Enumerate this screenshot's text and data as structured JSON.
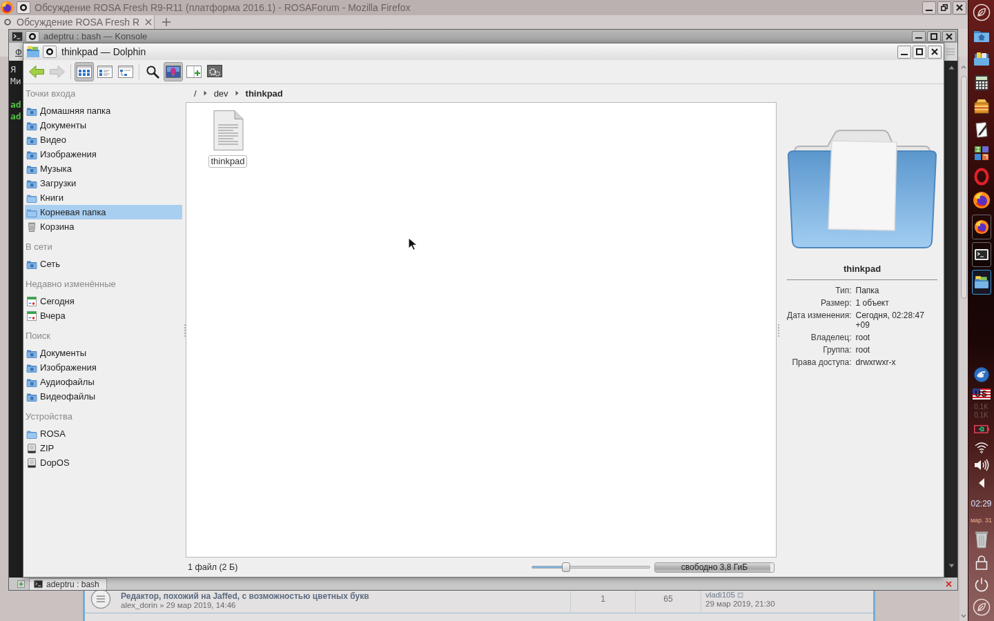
{
  "firefox": {
    "title": "Обсуждение ROSA Fresh R9-R11 (платформа 2016.1) - ROSAForum - Mozilla Firefox",
    "tabs": [
      {
        "label": "Обсуждение ROSA Fresh R",
        "selected": true
      }
    ],
    "topics": [
      {
        "title": "Редактор, похожий на Jaffed, с возможностью цветных букв",
        "byline": "alex_dorin » 29 мар 2019, 14:46",
        "replies": "1",
        "views": "65",
        "last_author": "vladi105",
        "last_date": "29 мар 2019, 21:30"
      }
    ]
  },
  "konsole": {
    "title": "adeptru : bash — Konsole",
    "menu": [
      "Ф"
    ],
    "lines": [
      {
        "kind": "output",
        "text": "Я"
      },
      {
        "kind": "output",
        "text": "Ми"
      },
      {
        "kind": "prompt",
        "text": "ad"
      },
      {
        "kind": "prompt",
        "text": "ad"
      }
    ],
    "sessions": [
      {
        "label": "adeptru : bash",
        "selected": true
      }
    ]
  },
  "dolphin": {
    "title": "thinkpad — Dolphin",
    "toolbar": {
      "navigation": [
        {
          "kind": "back",
          "disabled": false
        },
        {
          "kind": "forward",
          "disabled": true
        }
      ],
      "view_modes": [
        {
          "kind": "icons",
          "selected": true
        },
        {
          "kind": "compact",
          "selected": false
        },
        {
          "kind": "details",
          "selected": false
        }
      ],
      "preview": {
        "on": true
      }
    },
    "places": [
      {
        "heading": "Точки входа",
        "items": [
          {
            "label": "Домашняя папка",
            "kind": "place",
            "selected": false
          },
          {
            "label": "Документы",
            "kind": "place",
            "selected": false
          },
          {
            "label": "Видео",
            "kind": "place",
            "selected": false
          },
          {
            "label": "Изображения",
            "kind": "place",
            "selected": false
          },
          {
            "label": "Музыка",
            "kind": "place",
            "selected": false
          },
          {
            "label": "Загрузки",
            "kind": "place",
            "selected": false
          },
          {
            "label": "Книги",
            "kind": "folder",
            "selected": false
          },
          {
            "label": "Корневая папка",
            "kind": "folder",
            "selected": true
          },
          {
            "label": "Корзина",
            "kind": "trash",
            "selected": false
          }
        ]
      },
      {
        "heading": "В сети",
        "items": [
          {
            "label": "Сеть",
            "kind": "place",
            "selected": false
          }
        ]
      },
      {
        "heading": "Недавно изменённые",
        "items": [
          {
            "label": "Сегодня",
            "kind": "calendar",
            "selected": false
          },
          {
            "label": "Вчера",
            "kind": "calendar",
            "selected": false
          }
        ]
      },
      {
        "heading": "Поиск",
        "items": [
          {
            "label": "Документы",
            "kind": "place",
            "selected": false
          },
          {
            "label": "Изображения",
            "kind": "place",
            "selected": false
          },
          {
            "label": "Аудиофайлы",
            "kind": "place",
            "selected": false
          },
          {
            "label": "Видеофайлы",
            "kind": "place",
            "selected": false
          }
        ]
      },
      {
        "heading": "Устройства",
        "items": [
          {
            "label": "ROSA",
            "kind": "folder",
            "selected": false
          },
          {
            "label": "ZIP",
            "kind": "drive",
            "selected": false
          },
          {
            "label": "DopOS",
            "kind": "drive",
            "selected": false
          }
        ]
      }
    ],
    "breadcrumb": [
      {
        "label": "/",
        "current": false
      },
      {
        "label": "dev",
        "current": false
      },
      {
        "label": "thinkpad",
        "current": true
      }
    ],
    "files": [
      {
        "name": "thinkpad",
        "focused": true
      }
    ],
    "info": {
      "name": "thinkpad",
      "properties": [
        {
          "key": "Тип:",
          "value": "Папка"
        },
        {
          "key": "Размер:",
          "value": "1 объект"
        },
        {
          "key": "Дата изменения:",
          "value": "Сегодня, 02:28:47 +09"
        },
        {
          "key": "Владелец:",
          "value": "root"
        },
        {
          "key": "Группа:",
          "value": "root"
        },
        {
          "key": "Права доступа:",
          "value": "drwxrwxr-x"
        }
      ]
    },
    "status": {
      "summary": "1 файл (2 Б)",
      "zoom": {
        "level": 0.27
      },
      "free_space": {
        "label": "свободно 3,8 ГиБ",
        "level": 0.97
      }
    }
  },
  "dock": {
    "tasks": [
      {
        "active": false
      },
      {
        "active": false
      },
      {
        "active": true
      }
    ],
    "keyboard_layout": "US",
    "network_speed": [
      "0.1K",
      "0.1K"
    ],
    "clock": {
      "time": "02:29",
      "date": "мар. 31"
    }
  }
}
